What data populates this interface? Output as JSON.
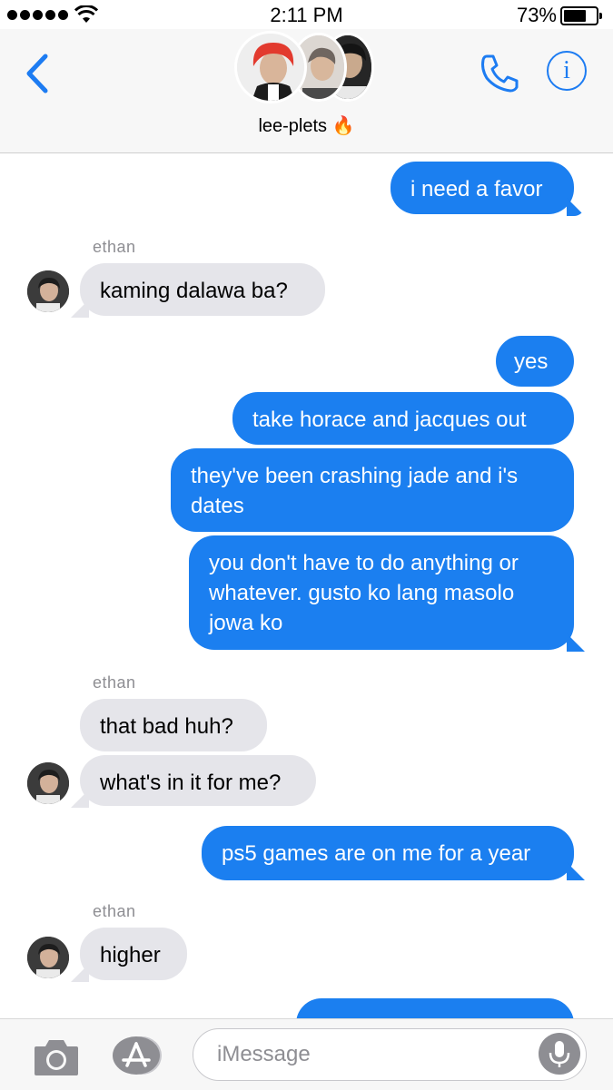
{
  "status_bar": {
    "time": "2:11 PM",
    "battery_percent": "73%",
    "battery_level": 0.73,
    "signal_bars": 5,
    "icons": [
      "signal-dots-icon",
      "wifi-icon",
      "battery-icon"
    ]
  },
  "header": {
    "group_name": "lee-plets",
    "group_emoji": "🔥",
    "icons": [
      "back-chevron-icon",
      "phone-icon",
      "info-icon"
    ],
    "accent_color": "#1d7cf2"
  },
  "messages": [
    {
      "direction": "out",
      "text": "i need a favor"
    },
    {
      "direction": "in",
      "sender": "ethan",
      "text": "kaming dalawa ba?"
    },
    {
      "direction": "out",
      "text": "yes"
    },
    {
      "direction": "out",
      "text": "take horace and jacques out"
    },
    {
      "direction": "out",
      "text": "they've been crashing jade and i's dates"
    },
    {
      "direction": "out",
      "text": "you don't have to do anything or whatever. gusto ko lang masolo jowa ko"
    },
    {
      "direction": "in",
      "sender": "ethan",
      "text": "that bad huh?"
    },
    {
      "direction": "in",
      "text": "what's in it for me?"
    },
    {
      "direction": "out",
      "text": "ps5 games are on me for a year"
    },
    {
      "direction": "in",
      "sender": "ethan",
      "text": "higher"
    },
    {
      "direction": "out",
      "text": ""
    }
  ],
  "colors": {
    "outgoing_bubble": "#1b7ff0",
    "incoming_bubble": "#e5e5ea"
  },
  "input_bar": {
    "placeholder": "iMessage",
    "icons": [
      "camera-icon",
      "app-store-icon",
      "microphone-icon"
    ]
  }
}
